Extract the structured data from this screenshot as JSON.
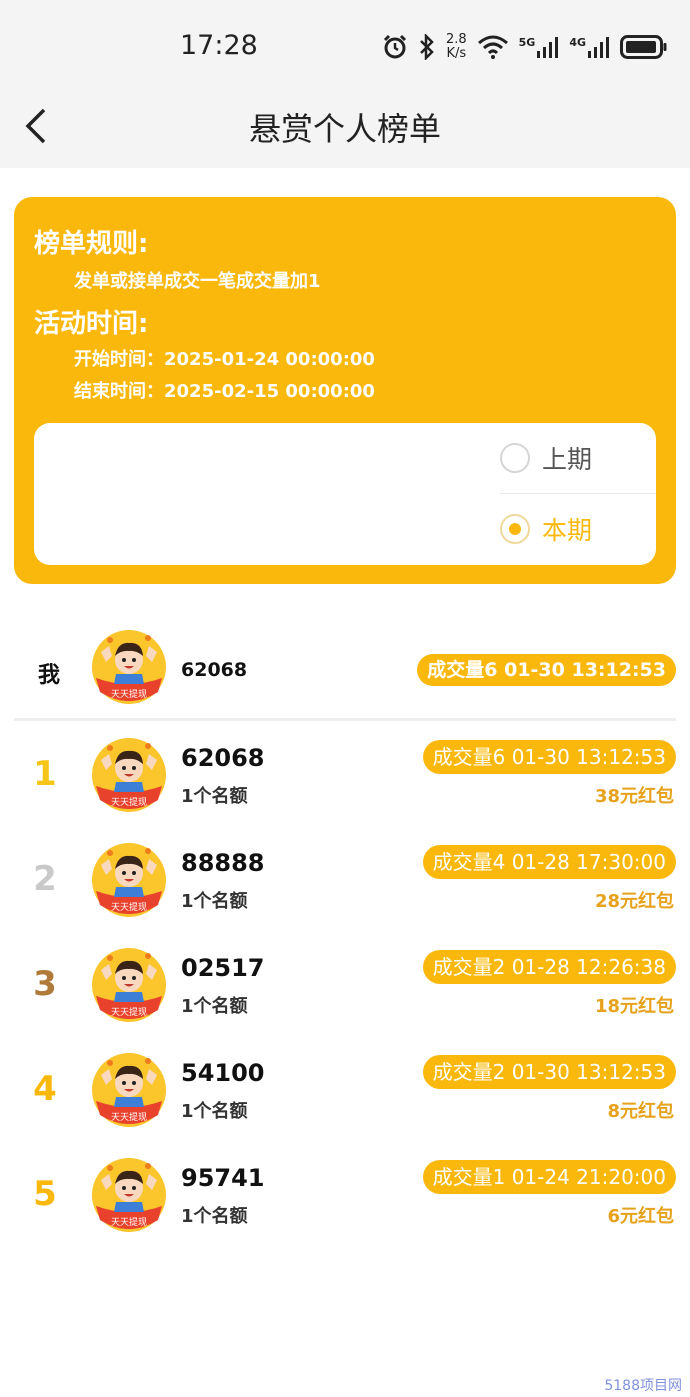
{
  "status_bar": {
    "time": "17:28",
    "net_speed_value": "2.8",
    "net_speed_unit": "K/s",
    "signal1_label": "5G",
    "signal2_label": "4G",
    "icons": [
      "alarm-icon",
      "bluetooth-icon",
      "wifi-icon",
      "signal-icon",
      "battery-icon"
    ]
  },
  "nav": {
    "title": "悬赏个人榜单",
    "back_icon": "chevron-left-icon"
  },
  "rules": {
    "rules_heading": "榜单规则:",
    "rules_text": "发单或接单成交一笔成交量加1",
    "time_heading": "活动时间:",
    "start_time": "开始时间：2025-01-24 00:00:00",
    "end_time": "结束时间：2025-02-15 00:00:00"
  },
  "period": {
    "options": [
      {
        "label": "上期",
        "selected": false
      },
      {
        "label": "本期",
        "selected": true
      }
    ]
  },
  "me": {
    "label": "我",
    "user_id": "62068",
    "stats": "成交量6 01-30 13:12:53",
    "avatar_caption": "天天提现"
  },
  "ranking": [
    {
      "rank": "1",
      "user_id": "62068",
      "quota": "1个名额",
      "stats": "成交量6 01-30 13:12:53",
      "reward": "38元红包",
      "rank_color": "#f5c518",
      "avatar_caption": "天天提现"
    },
    {
      "rank": "2",
      "user_id": "88888",
      "quota": "1个名额",
      "stats": "成交量4 01-28 17:30:00",
      "reward": "28元红包",
      "rank_color": "#c9c9c9",
      "avatar_caption": "天天提现"
    },
    {
      "rank": "3",
      "user_id": "02517",
      "quota": "1个名额",
      "stats": "成交量2 01-28 12:26:38",
      "reward": "18元红包",
      "rank_color": "#b07a3a",
      "avatar_caption": "天天提现"
    },
    {
      "rank": "4",
      "user_id": "54100",
      "quota": "1个名额",
      "stats": "成交量2 01-30 13:12:53",
      "reward": "8元红包",
      "rank_color": "#fbb80c",
      "avatar_caption": "天天提现"
    },
    {
      "rank": "5",
      "user_id": "95741",
      "quota": "1个名额",
      "stats": "成交量1 01-24 21:20:00",
      "reward": "6元红包",
      "rank_color": "#fbb80c",
      "avatar_caption": "天天提现"
    }
  ],
  "colors": {
    "accent": "#fbb80c",
    "reward_text": "#e6a21c"
  },
  "watermark": "5188项目网"
}
